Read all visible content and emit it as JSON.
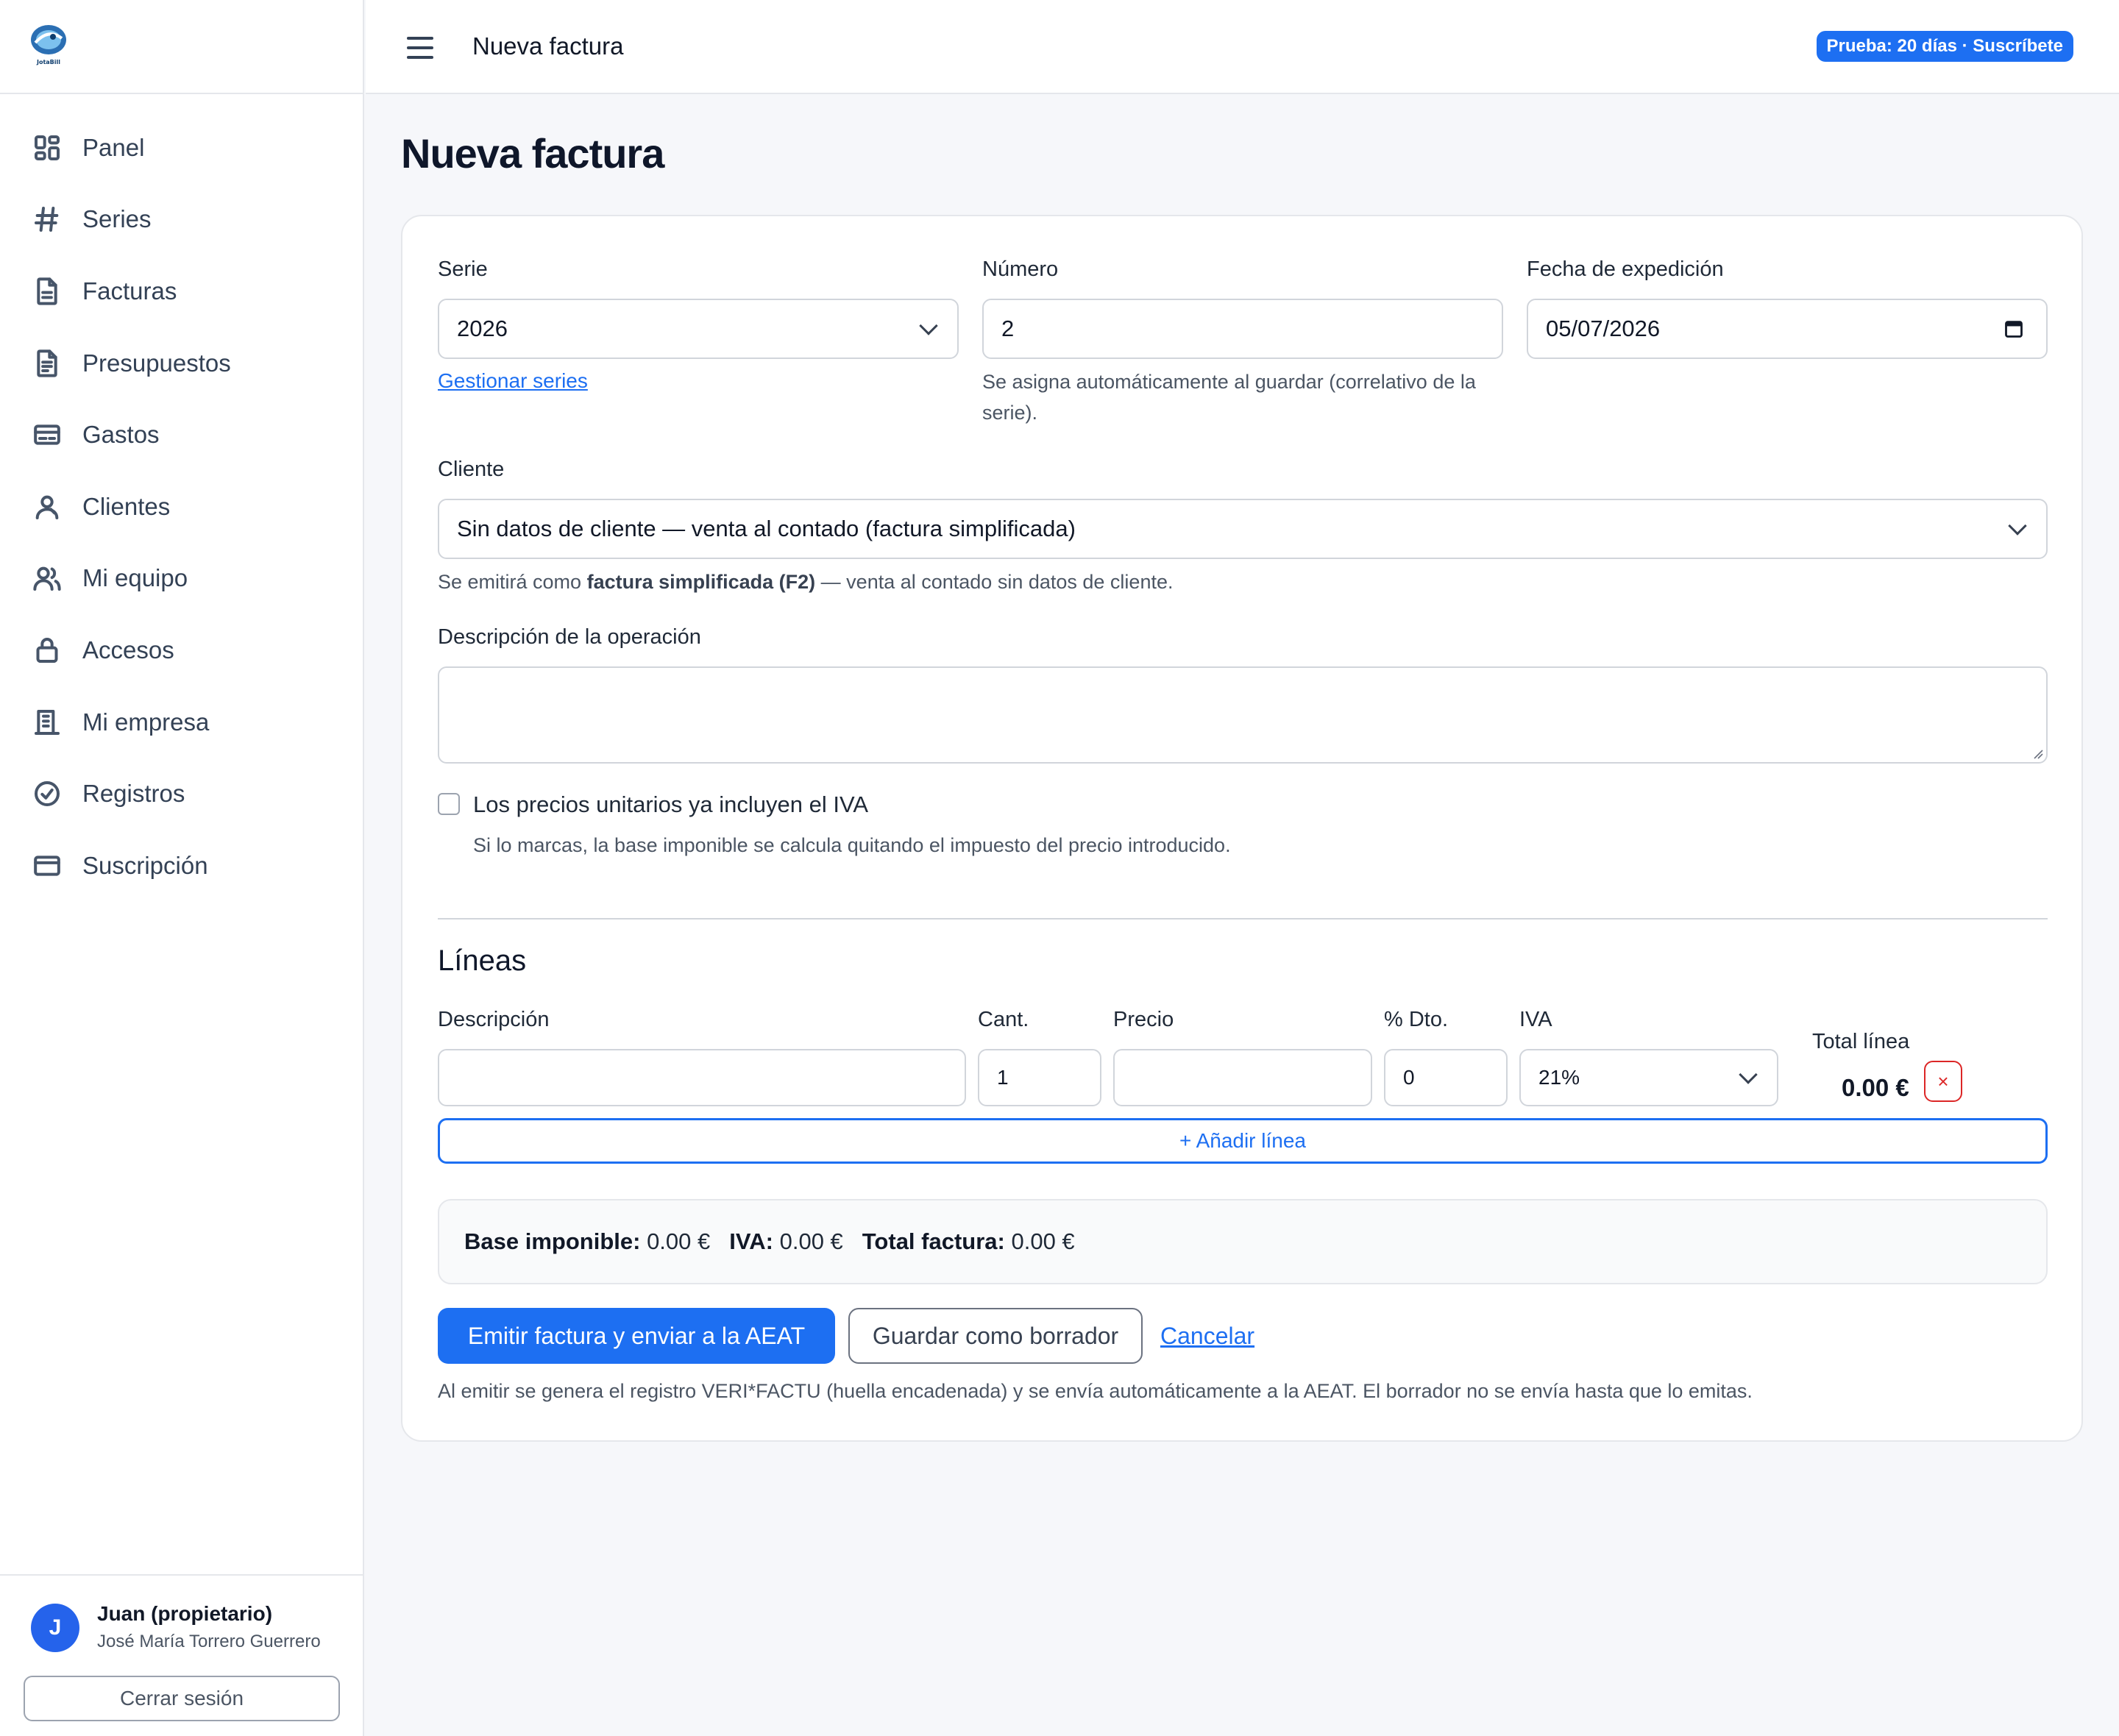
{
  "app": {
    "logo_alt": "JotaBill",
    "brand_color": "#1d6ff2"
  },
  "sidebar": {
    "items": [
      {
        "label": "Panel",
        "icon": "grid-icon"
      },
      {
        "label": "Series",
        "icon": "hash-icon"
      },
      {
        "label": "Facturas",
        "icon": "document-icon"
      },
      {
        "label": "Presupuestos",
        "icon": "document-list-icon"
      },
      {
        "label": "Gastos",
        "icon": "card-icon"
      },
      {
        "label": "Clientes",
        "icon": "client-icon"
      },
      {
        "label": "Mi equipo",
        "icon": "team-icon"
      },
      {
        "label": "Accesos",
        "icon": "lock-icon"
      },
      {
        "label": "Mi empresa",
        "icon": "building-icon"
      },
      {
        "label": "Registros",
        "icon": "check-circle-icon"
      },
      {
        "label": "Suscripción",
        "icon": "credit-card-icon"
      }
    ],
    "user": {
      "initial": "J",
      "name": "Juan (propietario)",
      "company": "José María Torrero Guerrero",
      "logout_label": "Cerrar sesión"
    }
  },
  "topbar": {
    "title": "Nueva factura",
    "trial_badge": "Prueba: 20 días · Suscríbete"
  },
  "main": {
    "page_title": "Nueva factura",
    "serie": {
      "label": "Serie",
      "value": "2026",
      "manage_link": "Gestionar series"
    },
    "numero": {
      "label": "Número",
      "value": "2",
      "help": "Se asigna automáticamente al guardar (correlativo de la serie)."
    },
    "fecha": {
      "label": "Fecha de expedición",
      "value": "05/07/2026"
    },
    "cliente": {
      "label": "Cliente",
      "value": "Sin datos de cliente — venta al contado (factura simplificada)",
      "help_pre": "Se emitirá como ",
      "help_bold": "factura simplificada (F2)",
      "help_post": " — venta al contado sin datos de cliente."
    },
    "descripcion": {
      "label": "Descripción de la operación",
      "value": ""
    },
    "iva_incluido": {
      "label": "Los precios unitarios ya incluyen el IVA",
      "checked": false,
      "help": "Si lo marcas, la base imponible se calcula quitando el impuesto del precio introducido."
    },
    "lineas": {
      "title": "Líneas",
      "headers": {
        "descripcion": "Descripción",
        "cantidad": "Cant.",
        "precio": "Precio",
        "dto": "% Dto.",
        "iva": "IVA",
        "total": "Total línea"
      },
      "rows": [
        {
          "descripcion": "",
          "cantidad": "1",
          "precio": "",
          "dto": "0",
          "iva": "21%",
          "total": "0.00 €",
          "remove": "×"
        }
      ],
      "add_label": "+ Añadir línea"
    },
    "totals": {
      "base_label": "Base imponible:",
      "base_value": "0.00 €",
      "iva_label": "IVA:",
      "iva_value": "0.00 €",
      "total_label": "Total factura:",
      "total_value": "0.00 €"
    },
    "actions": {
      "emit": "Emitir factura y enviar a la AEAT",
      "draft": "Guardar como borrador",
      "cancel": "Cancelar"
    },
    "footer_note": "Al emitir se genera el registro VERI*FACTU (huella encadenada) y se envía automáticamente a la AEAT. El borrador no se envía hasta que lo emitas."
  }
}
